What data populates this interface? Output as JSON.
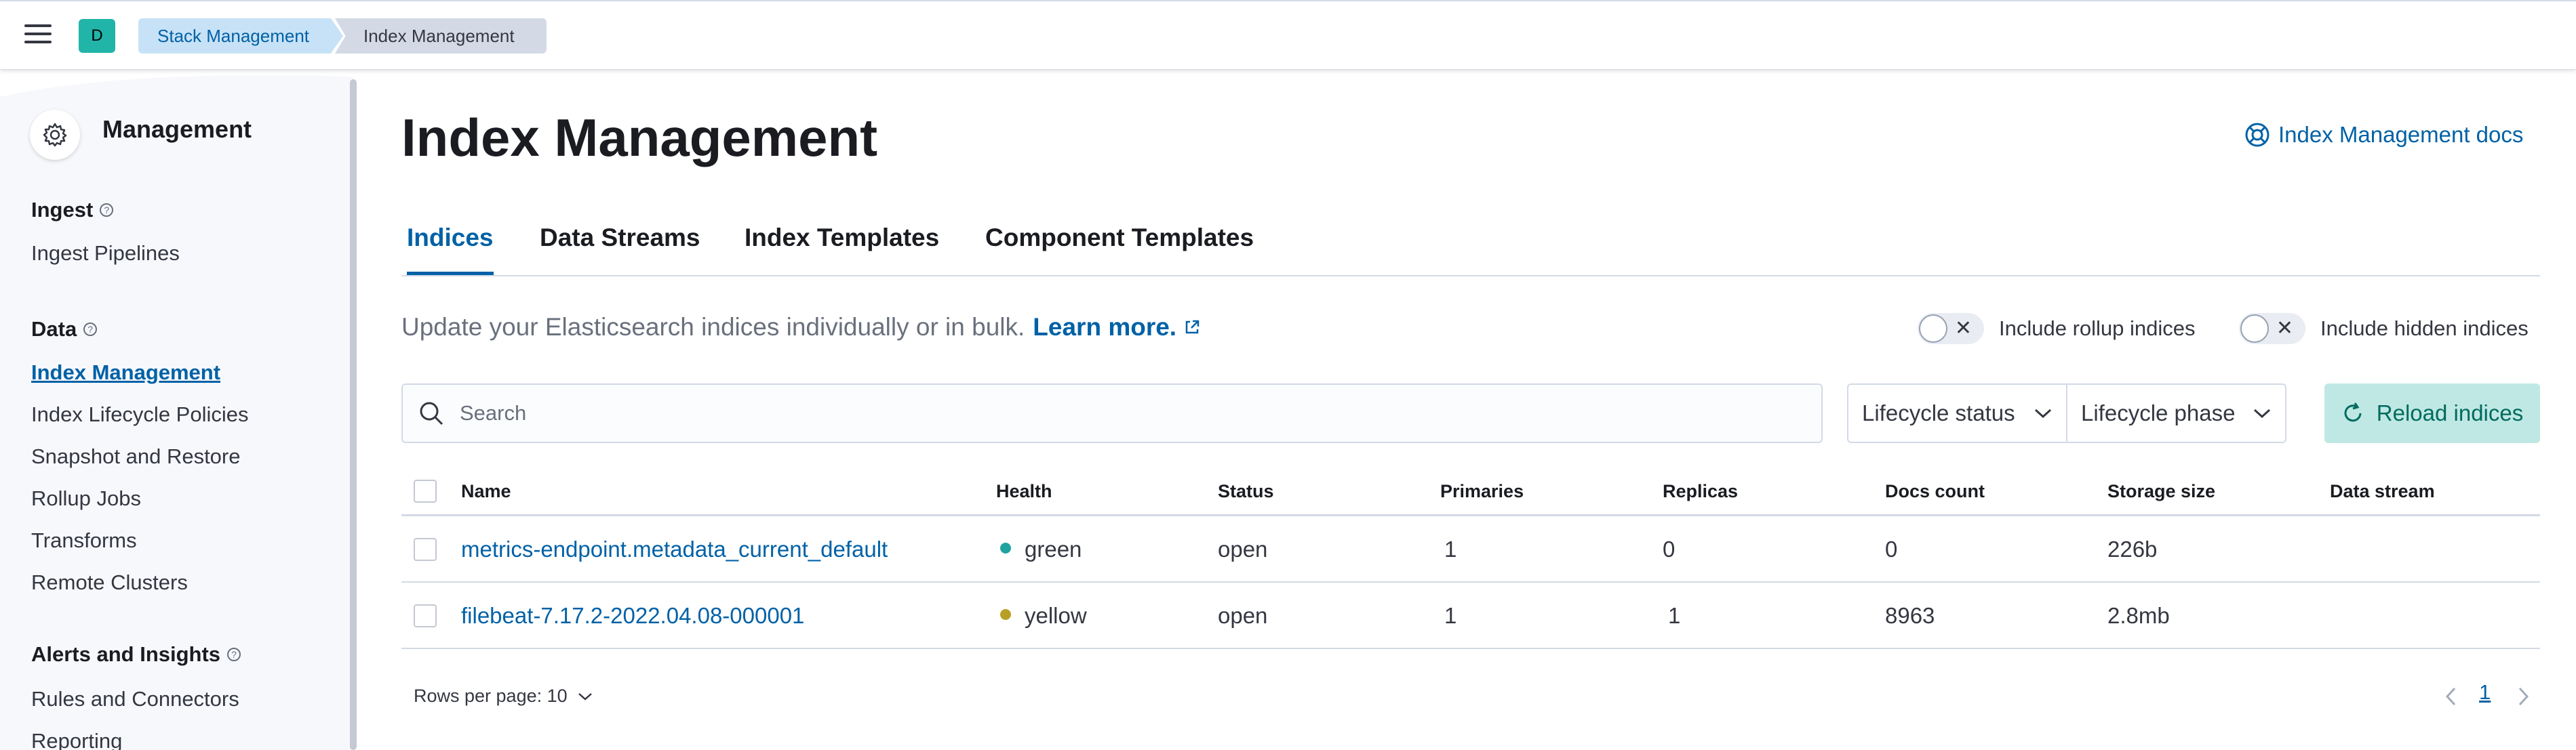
{
  "header": {
    "space_initial": "D",
    "breadcrumbs": [
      "Stack Management",
      "Index Management"
    ]
  },
  "sidebar": {
    "title": "Management",
    "sections": [
      {
        "title": "Ingest",
        "items": [
          "Ingest Pipelines"
        ]
      },
      {
        "title": "Data",
        "items": [
          "Index Management",
          "Index Lifecycle Policies",
          "Snapshot and Restore",
          "Rollup Jobs",
          "Transforms",
          "Remote Clusters"
        ]
      },
      {
        "title": "Alerts and Insights",
        "items": [
          "Rules and Connectors",
          "Reporting"
        ]
      }
    ],
    "active_item": "Index Management"
  },
  "main": {
    "title": "Index Management",
    "docs_link": "Index Management docs",
    "tabs": [
      "Indices",
      "Data Streams",
      "Index Templates",
      "Component Templates"
    ],
    "active_tab": "Indices",
    "description": "Update your Elasticsearch indices individually or in bulk.",
    "learn_more": "Learn more.",
    "toggles": {
      "rollup": "Include rollup indices",
      "hidden": "Include hidden indices"
    },
    "search": {
      "placeholder": "Search",
      "value": ""
    },
    "filters": [
      "Lifecycle status",
      "Lifecycle phase"
    ],
    "reload_label": "Reload indices",
    "table": {
      "columns": [
        "Name",
        "Health",
        "Status",
        "Primaries",
        "Replicas",
        "Docs count",
        "Storage size",
        "Data stream"
      ],
      "rows": [
        {
          "name": "metrics-endpoint.metadata_current_default",
          "health": "green",
          "status": "open",
          "primaries": "1",
          "replicas": "0",
          "docs_count": "0",
          "storage_size": "226b",
          "data_stream": ""
        },
        {
          "name": "filebeat-7.17.2-2022.04.08-000001",
          "health": "yellow",
          "status": "open",
          "primaries": "1",
          "replicas": "1",
          "docs_count": "8963",
          "storage_size": "2.8mb",
          "data_stream": ""
        }
      ]
    },
    "rows_per_page": "Rows per page: 10",
    "current_page": "1"
  },
  "colors": {
    "accent": "#0061a6",
    "health_green": "#20a3a0",
    "health_yellow": "#b9a025",
    "reload_bg": "#bfe8e4",
    "space_avatar": "#20b5a8"
  }
}
